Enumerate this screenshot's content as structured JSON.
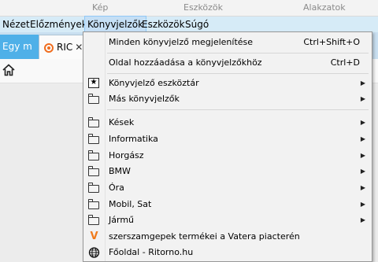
{
  "ribbon": {
    "group1": "Kép",
    "group2": "Eszközök",
    "group3": "Alakzatok"
  },
  "menubar": [
    {
      "label": "Nézet",
      "key": "menu-nezet"
    },
    {
      "label": "Előzmények",
      "key": "menu-elozmenyek"
    },
    {
      "label": "Könyvjelzők",
      "key": "menu-konyvjelzok"
    },
    {
      "label": "Eszközök",
      "key": "menu-eszkozok"
    },
    {
      "label": "Súgó",
      "key": "menu-sugo"
    }
  ],
  "tabs": {
    "tab1": {
      "label": "Egy m"
    },
    "tab2": {
      "label": "RIC",
      "close": "✕"
    }
  },
  "dropdown": {
    "show_all": {
      "label": "Minden könyvjelző megjelenítése",
      "shortcut": "Ctrl+Shift+O"
    },
    "add_page": {
      "label": "Oldal hozzáadása a könyvjelzőkhöz",
      "shortcut": "Ctrl+D"
    },
    "toolbar": {
      "label": "Könyvjelző eszköztár",
      "icon": "bookmark-toolbar-icon"
    },
    "other": {
      "label": "Más könyvjelzők",
      "icon": "folder-icon"
    },
    "folders": [
      {
        "label": "Kések",
        "icon": "folder-icon"
      },
      {
        "label": "Informatika",
        "icon": "folder-icon"
      },
      {
        "label": "Horgász",
        "icon": "folder-icon"
      },
      {
        "label": "BMW",
        "icon": "folder-icon"
      },
      {
        "label": "Óra",
        "icon": "folder-icon"
      },
      {
        "label": "Mobil, Sat",
        "icon": "folder-icon"
      },
      {
        "label": "Jármű",
        "icon": "folder-icon"
      }
    ],
    "bookmarks": [
      {
        "label": "szerszamgepek termékei a Vatera piacterén",
        "icon": "vatera-icon",
        "glyph": "V"
      },
      {
        "label": "Főoldal - Ritorno.hu",
        "icon": "globe-icon"
      }
    ],
    "submenu_arrow": "▶"
  },
  "colors": {
    "menubar_bg": "#d6ebf7",
    "tab_active": "#4fb0e8",
    "vatera_orange": "#f07b1d"
  }
}
